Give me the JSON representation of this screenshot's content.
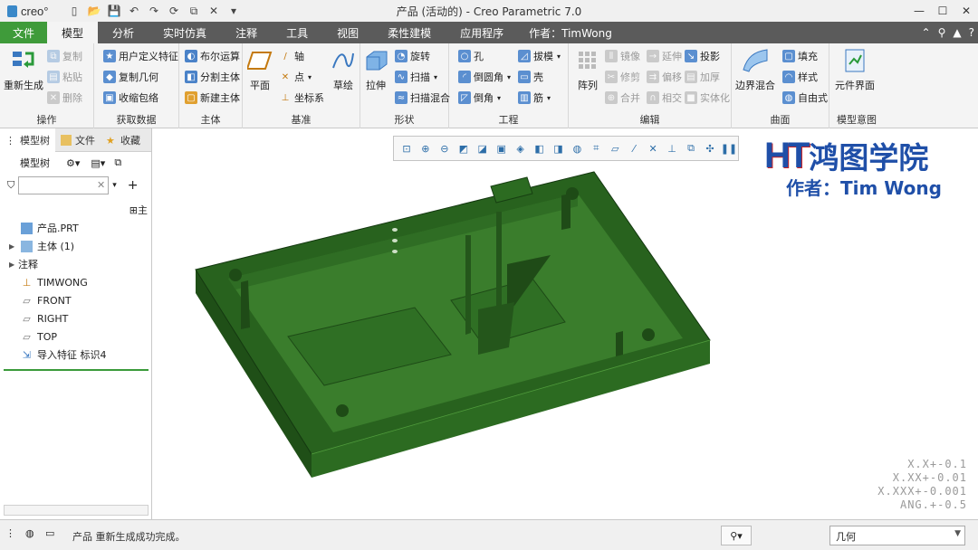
{
  "app": {
    "logo_text": "creo°",
    "window_title": "产品 (活动的) - Creo Parametric 7.0"
  },
  "ribbon_tabs": {
    "file": "文件",
    "model": "模型",
    "analysis": "分析",
    "simulation": "实时仿真",
    "annotate": "注释",
    "tools": "工具",
    "view": "视图",
    "flexible": "柔性建模",
    "applications": "应用程序",
    "author": "作者：TimWong"
  },
  "groups": {
    "operations": {
      "label": "操作",
      "regenerate": "重新生成",
      "copy": "复制",
      "paste": "粘贴",
      "delete": "删除"
    },
    "get_data": {
      "label": "获取数据",
      "udf": "用户定义特征",
      "copy_geom": "复制几何",
      "shrinkwrap": "收缩包络"
    },
    "body": {
      "label": "主体",
      "boolean": "布尔运算",
      "split": "分割主体",
      "new_body": "新建主体"
    },
    "datum": {
      "label": "基准",
      "plane": "平面",
      "axis": "轴",
      "point": "点",
      "csys": "坐标系",
      "sketch": "草绘"
    },
    "shapes": {
      "label": "形状",
      "extrude": "拉伸",
      "revolve": "旋转",
      "sweep": "扫描",
      "swept_blend": "扫描混合"
    },
    "engineering": {
      "label": "工程",
      "hole": "孔",
      "round": "倒圆角",
      "chamfer": "倒角",
      "draft": "拔模",
      "shell": "壳",
      "rib": "筋"
    },
    "editing": {
      "label": "编辑",
      "pattern": "阵列",
      "mirror": "镜像",
      "trim": "修剪",
      "merge": "合并",
      "extend": "延伸",
      "offset": "偏移",
      "intersect": "相交",
      "project": "投影",
      "thicken": "加厚",
      "solidify": "实体化"
    },
    "surfaces": {
      "label": "曲面",
      "boundary": "边界混合",
      "fill": "填充",
      "style": "样式",
      "freestyle": "自由式"
    },
    "intent": {
      "label": "模型意图",
      "component_interface": "元件界面"
    }
  },
  "left_panel": {
    "tabs": [
      "模型树",
      "文件",
      "收藏"
    ],
    "tree_header": "模型树",
    "tree": [
      {
        "label": "产品.PRT",
        "icon": "part-icon"
      },
      {
        "label": "主体 (1)",
        "icon": "body-icon"
      },
      {
        "label": "注释",
        "icon": ""
      },
      {
        "label": "TIMWONG",
        "icon": "csys-icon"
      },
      {
        "label": "FRONT",
        "icon": "plane-icon"
      },
      {
        "label": "RIGHT",
        "icon": "plane-icon"
      },
      {
        "label": "TOP",
        "icon": "plane-icon"
      },
      {
        "label": "导入特征 标识4",
        "icon": "import-icon"
      }
    ]
  },
  "graphics": {
    "watermark_cn": "鸿图学院",
    "watermark_logo": "HT",
    "watermark_author": "作者：Tim Wong",
    "tolerances": [
      "X.X+-0.1",
      "X.XX+-0.01",
      "X.XXX+-0.001",
      "ANG.+-0.5"
    ]
  },
  "status": {
    "message": "产品 重新生成成功完成。",
    "selection_filter": "几何"
  },
  "colors": {
    "model_green": "#2e6a22",
    "file_tab": "#3f9b3a",
    "tab_bar": "#5b5b5b"
  }
}
